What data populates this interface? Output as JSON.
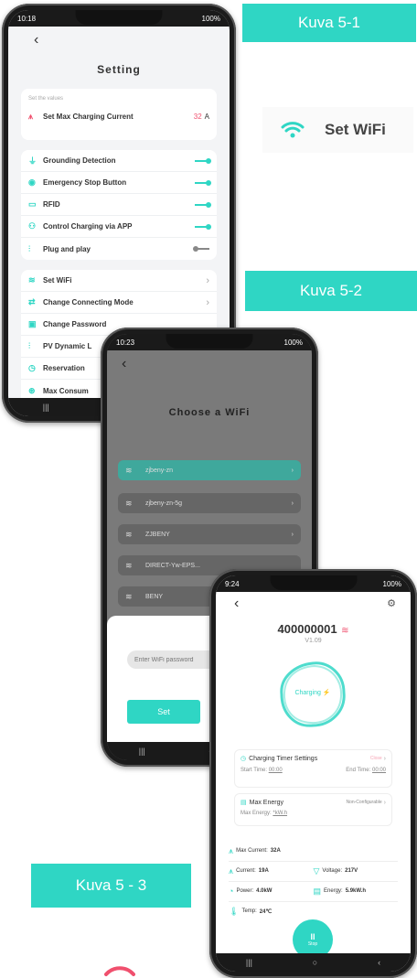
{
  "labels": {
    "kuva1": "Kuva 5-1",
    "kuva2": "Kuva 5-2",
    "kuva3": "Kuva 5 - 3"
  },
  "wifi_badge": {
    "text": "Set WiFi"
  },
  "phone1": {
    "status_time": "10:18",
    "status_right": "100%",
    "title": "Setting",
    "section_label": "Set the values",
    "max_current": {
      "label": "Set Max Charging Current",
      "value": "32",
      "unit": "A"
    },
    "toggles": [
      {
        "label": "Grounding Detection",
        "state": "on"
      },
      {
        "label": "Emergency Stop Button",
        "state": "on"
      },
      {
        "label": "RFID",
        "state": "on"
      },
      {
        "label": "Control Charging via APP",
        "state": "on"
      },
      {
        "label": "Plug and play",
        "state": "off"
      }
    ],
    "menu": [
      {
        "label": "Set WiFi"
      },
      {
        "label": "Change Connecting Mode"
      },
      {
        "label": "Change Password"
      },
      {
        "label": "PV Dynamic L"
      },
      {
        "label": "Reservation"
      },
      {
        "label": "Max Consum"
      }
    ]
  },
  "phone2": {
    "status_time": "10:23",
    "status_right": "100%",
    "title": "Choose a WiFi",
    "networks": [
      {
        "name": "zjbeny-zn"
      },
      {
        "name": "zjbeny-zn-5g"
      },
      {
        "name": "ZJBENY"
      },
      {
        "name": "DIRECT-Yw-EPS..."
      },
      {
        "name": "BENY"
      }
    ],
    "password_placeholder": "Enter WiFi password",
    "set_button": "Set"
  },
  "phone3": {
    "status_time": "9:24",
    "status_right": "100%",
    "device_id": "400000001",
    "version": "V1.09",
    "status": "Charging",
    "timer": {
      "title": "Charging Timer Settings",
      "state": "Close",
      "start_label": "Start Time:",
      "start_value": "00:00",
      "end_label": "End Time:",
      "end_value": "00:00"
    },
    "energy": {
      "title": "Max Energy",
      "state": "Non-Configurable",
      "label": "Max Energy:",
      "value": "*kW.h"
    },
    "stats": {
      "max_current_label": "Max Current:",
      "max_current": "32A",
      "current_label": "Current:",
      "current": "19A",
      "voltage_label": "Voltage:",
      "voltage": "217V",
      "power_label": "Power:",
      "power": "4.0kW",
      "energy_label": "Energy:",
      "energy": "5.9kW.h",
      "temp_label": "Temp:",
      "temp": "24℃"
    },
    "stop_button": "Stop"
  },
  "colors": {
    "accent": "#2fd6c4",
    "red": "#f0506e"
  }
}
